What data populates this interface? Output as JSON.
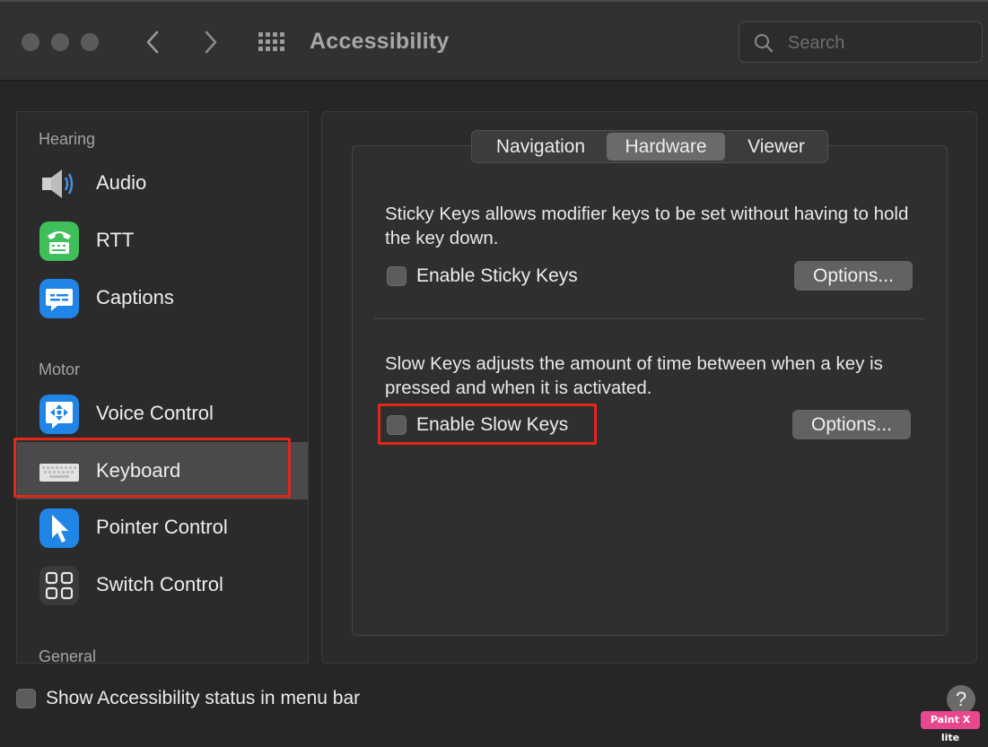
{
  "window": {
    "title": "Accessibility",
    "nav_back_icon": "chevron-left-icon",
    "nav_forward_icon": "chevron-right-icon",
    "grid_icon": "grid-icon"
  },
  "search": {
    "placeholder": "Search",
    "value": ""
  },
  "sidebar": {
    "sections": [
      {
        "label": "Hearing"
      },
      {
        "label": "Motor"
      },
      {
        "label": "General"
      }
    ],
    "items": [
      {
        "label": "Audio",
        "icon": "speaker-icon"
      },
      {
        "label": "RTT",
        "icon": "tty-icon"
      },
      {
        "label": "Captions",
        "icon": "captions-icon"
      },
      {
        "label": "Voice Control",
        "icon": "voice-control-icon"
      },
      {
        "label": "Keyboard",
        "icon": "keyboard-icon",
        "selected": true
      },
      {
        "label": "Pointer Control",
        "icon": "pointer-icon"
      },
      {
        "label": "Switch Control",
        "icon": "switch-control-icon"
      }
    ]
  },
  "tabs": [
    {
      "label": "Navigation"
    },
    {
      "label": "Hardware",
      "active": true
    },
    {
      "label": "Viewer"
    }
  ],
  "hardware": {
    "sticky": {
      "description": "Sticky Keys allows modifier keys to be set without having to hold the key down.",
      "checkbox_label": "Enable Sticky Keys",
      "checked": false,
      "options_label": "Options..."
    },
    "slow": {
      "description": "Slow Keys adjusts the amount of time between when a key is pressed and when it is activated.",
      "checkbox_label": "Enable Slow Keys",
      "checked": false,
      "options_label": "Options..."
    }
  },
  "footer": {
    "status_label": "Show Accessibility status in menu bar",
    "status_checked": false,
    "help_label": "?"
  },
  "watermark": "Paint X lite",
  "colors": {
    "highlight": "#e1261c",
    "selected_row": "#4a4a4a",
    "background": "#262626"
  }
}
